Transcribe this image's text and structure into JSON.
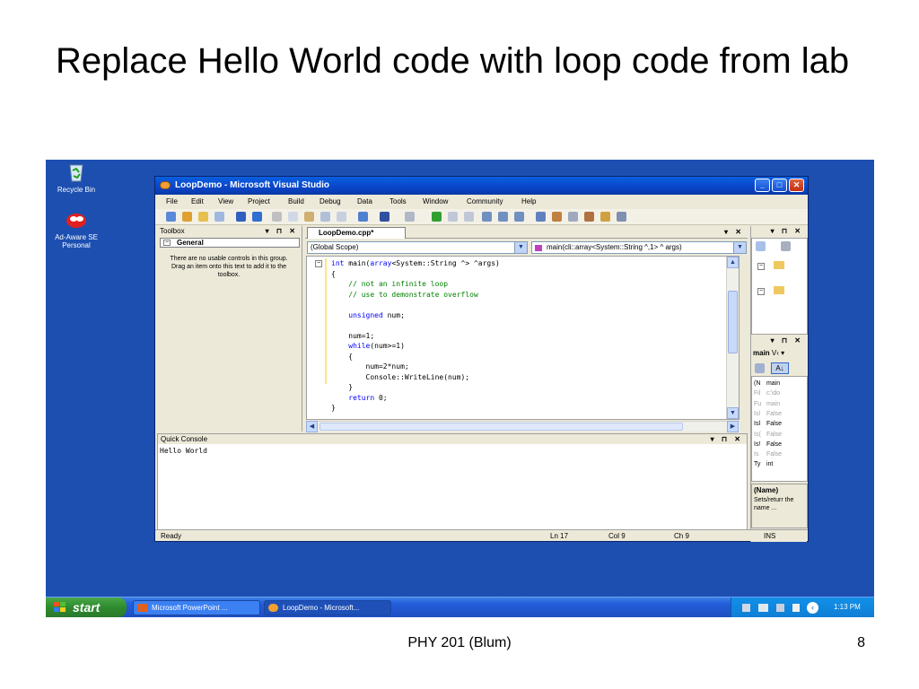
{
  "slide": {
    "title": "Replace Hello World code with loop code from lab",
    "footer": "PHY 201 (Blum)",
    "page_number": "8"
  },
  "desktop": {
    "icons": [
      {
        "label": "Recycle Bin",
        "icon": "recycle-bin-icon"
      },
      {
        "label": "Ad-Aware SE Personal",
        "icon": "ad-aware-icon"
      }
    ]
  },
  "window": {
    "title": "LoopDemo - Microsoft Visual Studio",
    "controls": {
      "minimize": "_",
      "maximize": "□",
      "close": "✕"
    },
    "menu": [
      "File",
      "Edit",
      "View",
      "Project",
      "Build",
      "Debug",
      "Data",
      "Tools",
      "Window",
      "Community",
      "Help"
    ]
  },
  "toolbox": {
    "title": "Toolbox",
    "controls": "▾ ⊓ ✕",
    "group": "General",
    "group_toggle": "−",
    "empty_text": "There are no usable controls in this group. Drag an item onto this text to add it to the toolbox."
  },
  "editor": {
    "tab": "LoopDemo.cpp*",
    "pane_controls": "▾ ✕",
    "scope": "(Global Scope)",
    "function": "main(cli::array<System::String ^,1> ^ args)",
    "code_lines": [
      {
        "parts": [
          {
            "t": "int",
            "k": "kw"
          },
          {
            "t": " main("
          },
          {
            "t": "array",
            "k": "kw"
          },
          {
            "t": "<System::String ^> ^args)"
          }
        ]
      },
      {
        "parts": [
          {
            "t": "{"
          }
        ]
      },
      {
        "parts": [
          {
            "t": "    "
          },
          {
            "t": "// not an infinite loop",
            "k": "cm"
          }
        ]
      },
      {
        "parts": [
          {
            "t": "    "
          },
          {
            "t": "// use to demonstrate overflow",
            "k": "cm"
          }
        ]
      },
      {
        "parts": [
          {
            "t": ""
          }
        ]
      },
      {
        "parts": [
          {
            "t": "    "
          },
          {
            "t": "unsigned",
            "k": "kw"
          },
          {
            "t": " num;"
          }
        ]
      },
      {
        "parts": [
          {
            "t": ""
          }
        ]
      },
      {
        "parts": [
          {
            "t": "    num=1;"
          }
        ]
      },
      {
        "parts": [
          {
            "t": "    "
          },
          {
            "t": "while",
            "k": "kw"
          },
          {
            "t": "(num>=1)"
          }
        ]
      },
      {
        "parts": [
          {
            "t": "    {"
          }
        ]
      },
      {
        "parts": [
          {
            "t": "        num=2*num;"
          }
        ]
      },
      {
        "parts": [
          {
            "t": "        Console::WriteLine(num);"
          }
        ]
      },
      {
        "parts": [
          {
            "t": "    }"
          }
        ]
      },
      {
        "parts": [
          {
            "t": "    "
          },
          {
            "t": "return",
            "k": "kw"
          },
          {
            "t": " 0;"
          }
        ]
      },
      {
        "parts": [
          {
            "t": "}"
          }
        ]
      }
    ]
  },
  "quick_console": {
    "title": "Quick Console",
    "controls": "▾ ⊓ ✕",
    "output": "Hello World"
  },
  "properties": {
    "pane_controls": "▾ ⊓ ✕",
    "object": "main",
    "object_suffix": "V‹ ▾",
    "sort_icon": "A↓",
    "rows": [
      {
        "name": "(N",
        "value": "main",
        "grey": false
      },
      {
        "name": "Fil",
        "value": "c:\\do",
        "grey": true
      },
      {
        "name": "Fu",
        "value": "main",
        "grey": true
      },
      {
        "name": "Isl",
        "value": "False",
        "grey": true
      },
      {
        "name": "Isl",
        "value": "False",
        "grey": false
      },
      {
        "name": "Is(",
        "value": "False",
        "grey": true
      },
      {
        "name": "Is!",
        "value": "False",
        "grey": false
      },
      {
        "name": "Is",
        "value": "False",
        "grey": true
      },
      {
        "name": "Ty",
        "value": "int",
        "grey": false
      }
    ],
    "desc_title": "(Name)",
    "desc_text": "Sets/returr the name ..."
  },
  "status": {
    "state": "Ready",
    "line": "Ln 17",
    "col": "Col 9",
    "ch": "Ch 9",
    "mode": "INS"
  },
  "taskbar": {
    "start": "start",
    "tasks": [
      "Microsoft PowerPoint ...",
      "LoopDemo - Microsoft..."
    ],
    "clock": "1:13 PM"
  }
}
